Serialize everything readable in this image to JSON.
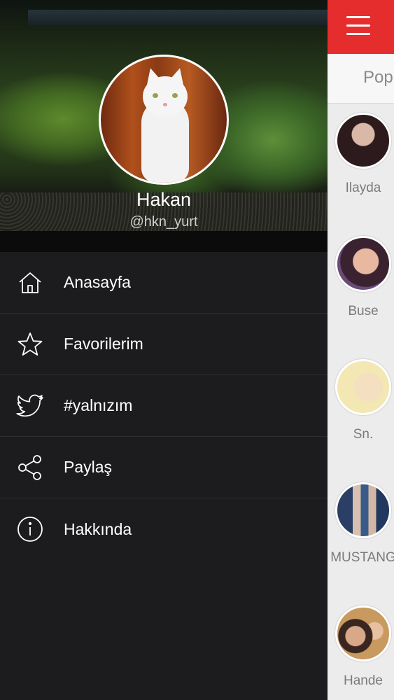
{
  "profile": {
    "name": "Hakan",
    "handle": "@hkn_yurt"
  },
  "menu": {
    "items": [
      {
        "label": "Anasayfa",
        "icon": "home-icon"
      },
      {
        "label": "Favorilerim",
        "icon": "star-icon"
      },
      {
        "label": "#yalnızım",
        "icon": "twitter-bird-icon"
      },
      {
        "label": "Paylaş",
        "icon": "share-icon"
      },
      {
        "label": "Hakkında",
        "icon": "info-icon"
      }
    ]
  },
  "right_panel": {
    "tab_label": "Pop",
    "accent_color": "#e62d2d",
    "people": [
      {
        "name": "Ilayda"
      },
      {
        "name": "Buse"
      },
      {
        "name": "Sn."
      },
      {
        "name": "MUSTANG"
      },
      {
        "name": "Hande"
      }
    ]
  }
}
